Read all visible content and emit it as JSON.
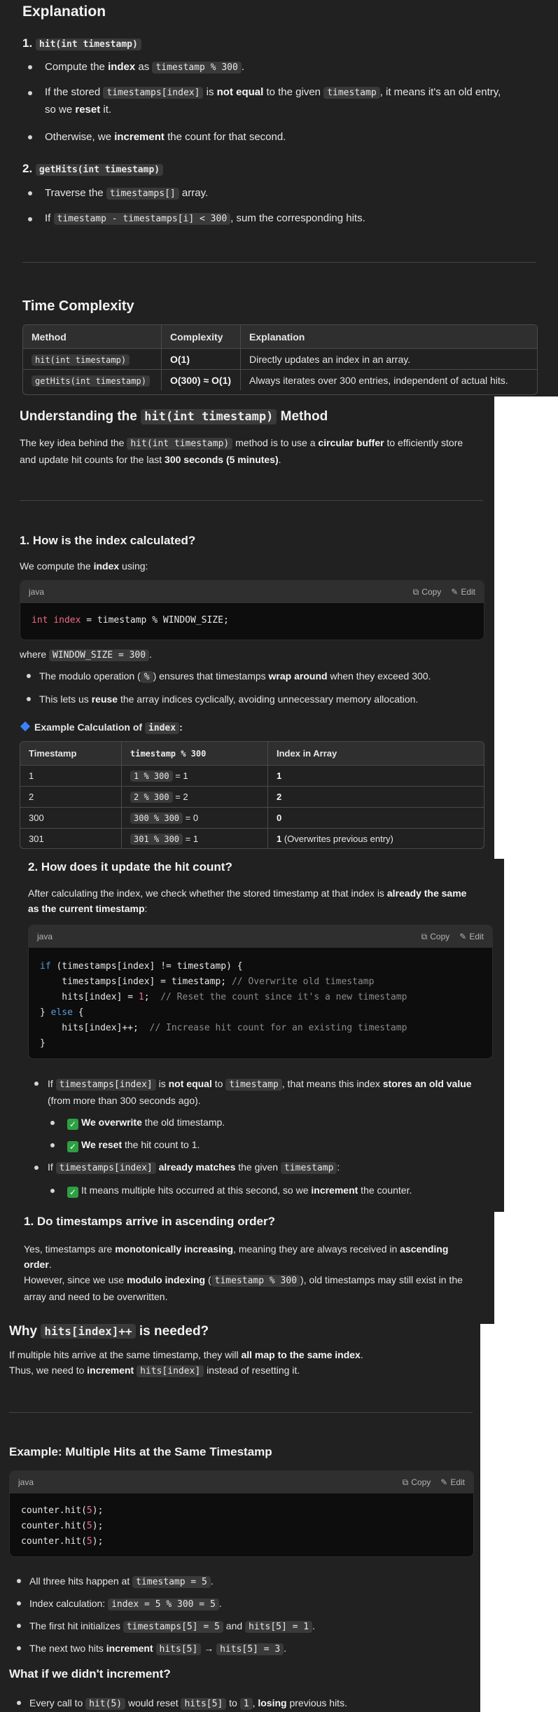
{
  "s1": {
    "title": "Explanation",
    "step1_num": "1.",
    "step1_code": "hit(int timestamp)",
    "b1_pre": "Compute the ",
    "b1_bold": "index",
    "b1_mid": " as ",
    "b1_code": "timestamp % 300",
    "b1_post": ".",
    "b2_pre": "If the stored ",
    "b2_code1": "timestamps[index]",
    "b2_mid1": " is ",
    "b2_bold1": "not equal",
    "b2_mid2": " to the given ",
    "b2_code2": "timestamp",
    "b2_mid3": ", it means it's an old entry,",
    "b2_line2_pre": "so we ",
    "b2_bold2": "reset",
    "b2_line2_post": " it.",
    "b3_pre": "Otherwise, we ",
    "b3_bold": "increment",
    "b3_post": " the count for that second.",
    "step2_num": "2.",
    "step2_code": "getHits(int timestamp)",
    "b4_pre": "Traverse the ",
    "b4_code": "timestamps[]",
    "b4_post": " array.",
    "b5_pre": "If ",
    "b5_code": "timestamp - timestamps[i] < 300",
    "b5_post": ", sum the corresponding hits.",
    "tc_title": "Time Complexity",
    "tc_headers": [
      "Method",
      "Complexity",
      "Explanation"
    ],
    "tc_rows": [
      {
        "method": "hit(int timestamp)",
        "complexity": "O(1)",
        "explanation": "Directly updates an index in an array."
      },
      {
        "method": "getHits(int timestamp)",
        "complexity": "O(300) ≈ O(1)",
        "explanation": "Always iterates over 300 entries, independent of actual hits."
      }
    ]
  },
  "s2": {
    "title_pre": "Understanding the ",
    "title_code": "hit(int timestamp)",
    "title_post": " Method",
    "p1_pre": "The key idea behind the ",
    "p1_code": "hit(int timestamp)",
    "p1_mid": " method is to use a ",
    "p1_bold": "circular buffer",
    "p1_post": " to efficiently store",
    "p1_line2_pre": "and update hit counts for the last ",
    "p1_line2_bold": "300 seconds (5 minutes)",
    "p1_line2_post": ".",
    "q1_title": "1. How is the index calculated?",
    "q1_p_pre": "We compute the ",
    "q1_p_bold": "index",
    "q1_p_post": " using:",
    "code_lang": "java",
    "copy": "Copy",
    "edit": "Edit",
    "code_type": "int",
    "code_var": "index",
    "code_rest": " = timestamp % WINDOW_SIZE;",
    "where_pre": "where ",
    "where_code": "WINDOW_SIZE = 300",
    "where_post": ".",
    "m1_pre": "The modulo operation (",
    "m1_code": "%",
    "m1_mid": ") ensures that timestamps ",
    "m1_bold": "wrap around",
    "m1_post": " when they exceed 300.",
    "m2_pre": "This lets us ",
    "m2_bold": "reuse",
    "m2_post": " the array indices cyclically, avoiding unnecessary memory allocation.",
    "ex_title_pre": "Example Calculation of ",
    "ex_title_code": "index",
    "ex_title_post": ":",
    "ex_headers": [
      "Timestamp",
      "timestamp % 300",
      "Index in Array"
    ],
    "ex_rows": [
      {
        "ts": "1",
        "expr": "1 % 300",
        "res": " = 1",
        "idx": "1",
        "note": ""
      },
      {
        "ts": "2",
        "expr": "2 % 300",
        "res": " = 2",
        "idx": "2",
        "note": ""
      },
      {
        "ts": "300",
        "expr": "300 % 300",
        "res": " = 0",
        "idx": "0",
        "note": ""
      },
      {
        "ts": "301",
        "expr": "301 % 300",
        "res": " = 1",
        "idx": "1",
        "note": " (Overwrites previous entry)"
      }
    ]
  },
  "s3": {
    "title": "2. How does it update the hit count?",
    "p_pre": "After calculating the index, we check whether the stored timestamp at that index is ",
    "p_bold": "already the same",
    "p_line2_bold": "as the current timestamp",
    "p_line2_post": ":",
    "code_lang": "java",
    "copy": "Copy",
    "edit": "Edit",
    "l1_kw": "if",
    "l1_rest": " (timestamps[index] != timestamp) {",
    "l2_code": "    timestamps[index] = timestamp; ",
    "l2_cm": "// Overwrite old timestamp",
    "l3_pre": "    hits[index] = ",
    "l3_num": "1",
    "l3_semi": ";  ",
    "l3_cm": "// Reset the count since it's a new timestamp",
    "l4_pre": "} ",
    "l4_kw": "else",
    "l4_post": " {",
    "l5_code": "    hits[index]++;  ",
    "l5_cm": "// Increase hit count for an existing timestamp",
    "l6": "}",
    "b1_pre": "If ",
    "b1_code1": "timestamps[index]",
    "b1_mid": " is ",
    "b1_bold1": "not equal",
    "b1_mid2": " to ",
    "b1_code2": "timestamp",
    "b1_mid3": ", that means this index ",
    "b1_bold2": "stores an old value",
    "b1_line2": "(from more than 300 seconds ago).",
    "sb1_bold": "We overwrite",
    "sb1_post": " the old timestamp.",
    "sb2_bold": "We reset",
    "sb2_post": " the hit count to 1.",
    "b2_pre": "If ",
    "b2_code1": "timestamps[index]",
    "b2_bold": " already matches",
    "b2_mid": " the given ",
    "b2_code2": "timestamp",
    "b2_post": ":",
    "sb3_pre": "It means multiple hits occurred at this second, so we ",
    "sb3_bold": "increment",
    "sb3_post": " the counter.",
    "check": "✓"
  },
  "s4": {
    "title": "1. Do timestamps arrive in ascending order?",
    "p1_pre": "Yes, timestamps are ",
    "p1_bold1": "monotonically increasing",
    "p1_mid": ", meaning they are always received in ",
    "p1_bold2": "ascending",
    "p1_line2_bold": "order",
    "p1_line2_post": ".",
    "p2_pre": "However, since we use ",
    "p2_bold": "modulo indexing",
    "p2_mid": " (",
    "p2_code": "timestamp % 300",
    "p2_post": "), old timestamps may still exist in the",
    "p2_line2": "array and need to be overwritten."
  },
  "s5": {
    "title_pre": "Why ",
    "title_code": "hits[index]++",
    "title_post": " is needed?",
    "p1_pre": "If multiple hits arrive at the same timestamp, they will ",
    "p1_bold": "all map to the same index",
    "p1_post": ".",
    "p2_pre": "Thus, we need to ",
    "p2_bold": "increment",
    "p2_code": "hits[index]",
    "p2_post": " instead of resetting it.",
    "ex_title": "Example: Multiple Hits at the Same Timestamp",
    "code_lang": "java",
    "copy": "Copy",
    "edit": "Edit",
    "code_line": "counter.hit(",
    "code_num": "5",
    "code_end": ");",
    "b1_pre": "All three hits happen at ",
    "b1_code": "timestamp = 5",
    "b1_post": ".",
    "b2_pre": "Index calculation: ",
    "b2_code": "index = 5 % 300 = 5",
    "b2_post": ".",
    "b3_pre": "The first hit initializes ",
    "b3_code1": "timestamps[5] = 5",
    "b3_mid": " and ",
    "b3_code2": "hits[5] = 1",
    "b3_post": ".",
    "b4_pre": "The next two hits ",
    "b4_bold": "increment",
    "b4_code1": "hits[5]",
    "b4_arrow": " → ",
    "b4_code2": "hits[5] = 3",
    "b4_post": ".",
    "wi_title": "What if we didn't increment?",
    "b5_pre": "Every call to ",
    "b5_code1": "hit(5)",
    "b5_mid": " would reset ",
    "b5_code2": "hits[5]",
    "b5_mid2": " to ",
    "b5_code3": "1",
    "b5_mid3": ", ",
    "b5_bold": "losing",
    "b5_post": " previous hits."
  }
}
